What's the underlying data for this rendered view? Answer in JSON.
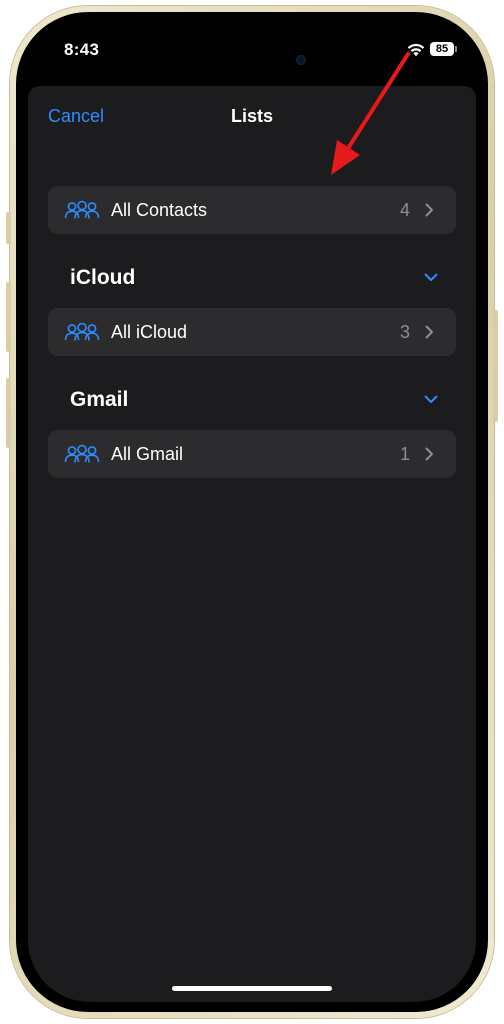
{
  "status_bar": {
    "time": "8:43",
    "battery_level": "85",
    "icons": [
      "wifi-icon",
      "battery-icon"
    ]
  },
  "nav": {
    "cancel_label": "Cancel",
    "title": "Lists"
  },
  "all_contacts": {
    "label": "All Contacts",
    "count": "4",
    "icon": "group-icon"
  },
  "sections": [
    {
      "title": "iCloud",
      "row": {
        "label": "All iCloud",
        "count": "3",
        "icon": "group-icon"
      }
    },
    {
      "title": "Gmail",
      "row": {
        "label": "All Gmail",
        "count": "1",
        "icon": "group-icon"
      }
    }
  ],
  "colors": {
    "accent": "#2f8cff",
    "sheet_background": "#1c1c1e",
    "row_background": "#2c2c2e",
    "secondary_text": "#8e8e93",
    "annotation_arrow": "#e8191c",
    "frame": "#e3dab8"
  }
}
